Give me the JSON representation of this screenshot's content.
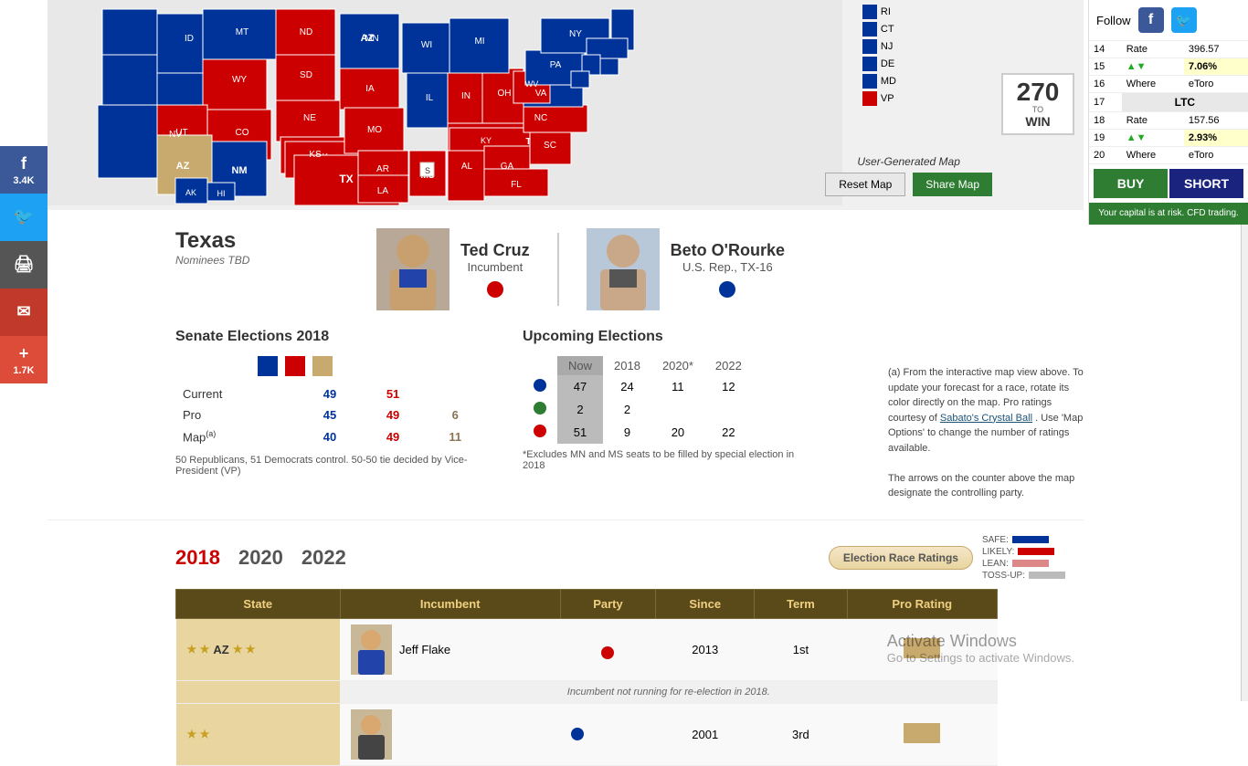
{
  "social": {
    "facebook_label": "f",
    "facebook_count": "3.4K",
    "twitter_label": "t",
    "print_label": "🖨",
    "email_label": "✉",
    "plus_label": "+",
    "plus_count": "1.7K"
  },
  "map": {
    "counter": "270",
    "counter_sub": "TO",
    "counter_win": "WIN",
    "user_generated_label": "User-Generated Map",
    "reset_button": "Reset Map",
    "share_button": "Share Map"
  },
  "legend": {
    "items": [
      {
        "label": "RI",
        "color": "#003399"
      },
      {
        "label": "CT",
        "color": "#003399"
      },
      {
        "label": "NJ",
        "color": "#003399"
      },
      {
        "label": "DE",
        "color": "#003399"
      },
      {
        "label": "MD",
        "color": "#003399"
      },
      {
        "label": "VP",
        "color": "#cc0000"
      }
    ]
  },
  "texas": {
    "state_name": "Texas",
    "nominees_label": "Nominees TBD"
  },
  "candidates": {
    "candidate1": {
      "name": "Ted Cruz",
      "title": "Incumbent",
      "party_color": "#cc0000"
    },
    "candidate2": {
      "name": "Beto O'Rourke",
      "title": "U.S. Rep., TX-16",
      "party_color": "#003399"
    }
  },
  "senate": {
    "title": "Senate Elections 2018",
    "rows": [
      {
        "label": "Current",
        "blue": "49",
        "red": "51",
        "tan": ""
      },
      {
        "label": "Pro",
        "blue": "45",
        "red": "49",
        "tan": "6"
      },
      {
        "label": "Map(a)",
        "blue": "40",
        "red": "49",
        "tan": "11"
      }
    ],
    "footnote": "50 Republicans, 51 Democrats control. 50-50 tie decided by Vice-President (VP)"
  },
  "upcoming": {
    "title": "Upcoming Elections",
    "headers": [
      "Now",
      "2018",
      "2020*",
      "2022"
    ],
    "rows": [
      {
        "color": "blue",
        "now": "47",
        "y2018": "24",
        "y2020": "11",
        "y2022": "12"
      },
      {
        "color": "green",
        "now": "2",
        "y2018": "2",
        "y2020": "",
        "y2022": ""
      },
      {
        "color": "red",
        "now": "51",
        "y2018": "9",
        "y2020": "20",
        "y2022": "22"
      }
    ],
    "footnote": "*Excludes MN and MS seats to be filled by special election in 2018"
  },
  "notes": {
    "text1": "(a) From the interactive map view above. To update your forecast for a race, rotate its color directly on the map. Pro ratings courtesy of",
    "sabato_link": "Sabato's Crystal Ball",
    "text2": ". Use 'Map Options' to change the number of ratings available.",
    "text3": "The arrows on the counter above the map designate the controlling party."
  },
  "year_tabs": {
    "years": [
      "2018",
      "2020",
      "2022"
    ],
    "active": "2018",
    "ratings_label": "Election Race Ratings"
  },
  "ratings_legend": {
    "items": [
      {
        "label": "SAFE:",
        "color": "#003399"
      },
      {
        "label": "LIKELY:",
        "color": "#5577cc"
      },
      {
        "label": "LEAN:",
        "color": "#99aadd"
      },
      {
        "label": "TOSS-UP:",
        "color": "#bbbbbb"
      }
    ]
  },
  "incumbent_table": {
    "headers": [
      "State",
      "Incumbent",
      "Party",
      "Since",
      "Term",
      "Pro Rating"
    ],
    "rows": [
      {
        "state": "AZ",
        "incumbent": "Jeff Flake",
        "party_color": "#cc0000",
        "since": "2013",
        "term": "1st",
        "pro_rating_color": "#c8a96e",
        "sub_text": "Incumbent not running for re-election in 2018."
      }
    ]
  },
  "crypto": {
    "follow_label": "Follow",
    "rows": [
      {
        "num": "14",
        "label": "Rate",
        "value": "396.57",
        "highlight": false
      },
      {
        "num": "15",
        "label": "",
        "value": "7.06%",
        "highlight": true,
        "direction": "up"
      },
      {
        "num": "16",
        "label": "Where",
        "value": "eToro",
        "highlight": false
      },
      {
        "num": "17",
        "label": "LTC",
        "value": "",
        "highlight": false,
        "is_header": true
      },
      {
        "num": "18",
        "label": "Rate",
        "value": "157.56",
        "highlight": false
      },
      {
        "num": "19",
        "label": "",
        "value": "2.93%",
        "highlight": true,
        "direction": "up"
      },
      {
        "num": "20",
        "label": "Where",
        "value": "eToro",
        "highlight": false
      }
    ],
    "buy_label": "BUY",
    "short_label": "SHORT",
    "risk_notice": "Your capital is at risk. CFD trading."
  },
  "activate_windows": {
    "line1": "Activate Windows",
    "line2": "Go to Settings to activate Windows."
  }
}
